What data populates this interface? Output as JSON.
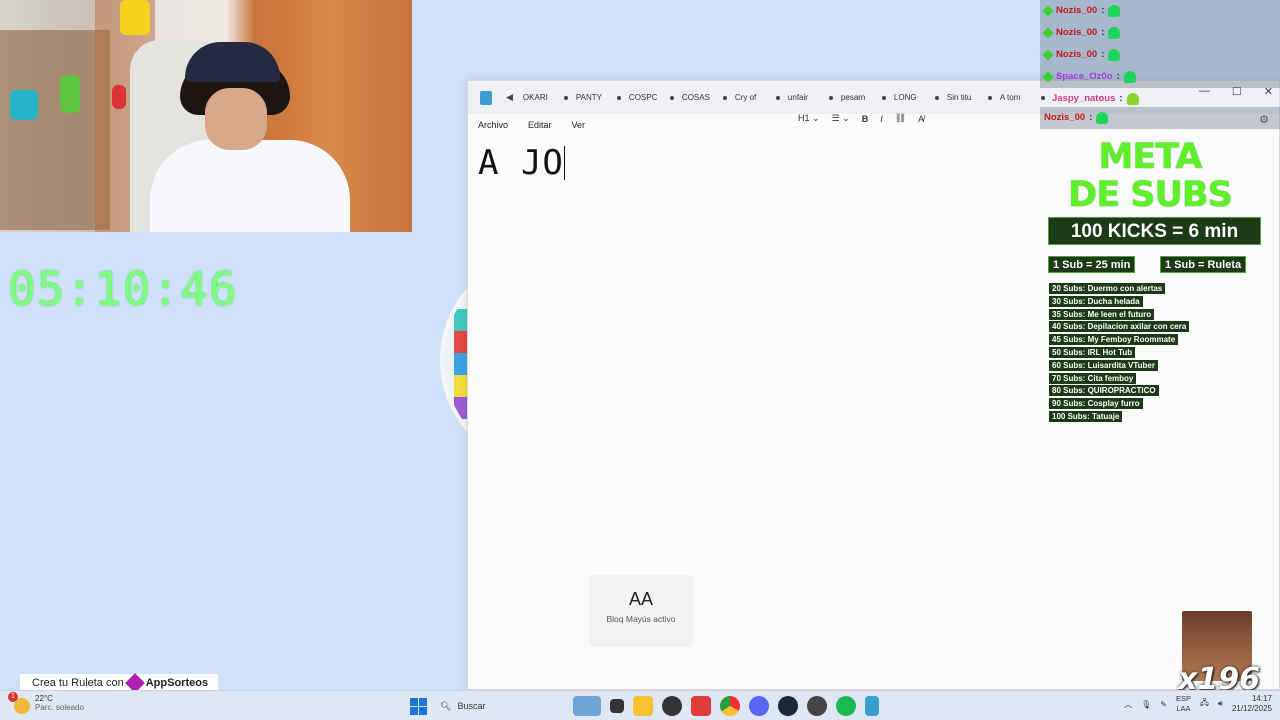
{
  "timer": {
    "value": "05:10:46"
  },
  "notepad": {
    "tabs": [
      "OKARI",
      "PANTY",
      "COSPC",
      "COSAS",
      "Cry of",
      "unfair",
      "pesarn",
      "LONG",
      "Sin titu",
      "A tom"
    ],
    "new_tab_icon": "plus-icon",
    "menu": [
      "Archivo",
      "Editar",
      "Ver"
    ],
    "format": {
      "heading": "H1"
    },
    "content": "A JO"
  },
  "caps_lock": {
    "glyph": "AA",
    "label": "Bloq Mayús activo"
  },
  "chat": [
    {
      "user": "Nozis_00",
      "sep": ":",
      "color": "#c41818"
    },
    {
      "user": "Nozis_00",
      "sep": ":",
      "color": "#c41818"
    },
    {
      "user": "Nozis_00",
      "sep": ":",
      "color": "#c41818"
    },
    {
      "user": "Space_Oz0o",
      "sep": ":",
      "color": "#a637d8"
    },
    {
      "user": "Jaspy_natous",
      "sep": ":",
      "color": "#d83b8a"
    },
    {
      "user": "Nozis_00",
      "sep": ":",
      "color": "#c41818"
    }
  ],
  "goals": {
    "title_line1": "META",
    "title_line2": "DE SUBS",
    "kicks": "100 KICKS = 6 min",
    "sub_time": "1 Sub = 25 min",
    "sub_roulette": "1 Sub = Ruleta",
    "list": [
      "20 Subs: Duermo con alertas",
      "30 Subs: Ducha helada",
      "35 Subs: Me leen el futuro",
      "40 Subs: Depilacion axilar con cera",
      "45 Subs: My Femboy Roommate",
      "50 Subs: IRL Hot Tub",
      "60 Subs: Luisardita VTuber",
      "70 Subs: Cita femboy",
      "80 Subs: QUIROPRACTICO",
      "90 Subs: Cosplay furro",
      "100 Subs: Tatuaje"
    ],
    "accent": "#5ef028"
  },
  "meme": {
    "text": "x196"
  },
  "promo": {
    "prefix": "Crea tu Ruleta con",
    "brand": "AppSorteos"
  },
  "taskbar": {
    "weather_temp": "22°C",
    "weather_desc": "Parc. soleado",
    "weather_badge": "1",
    "search_placeholder": "Buscar",
    "lang_top": "ESP",
    "lang_bottom": "LAA",
    "time": "14:17",
    "date": "21/12/2025"
  }
}
